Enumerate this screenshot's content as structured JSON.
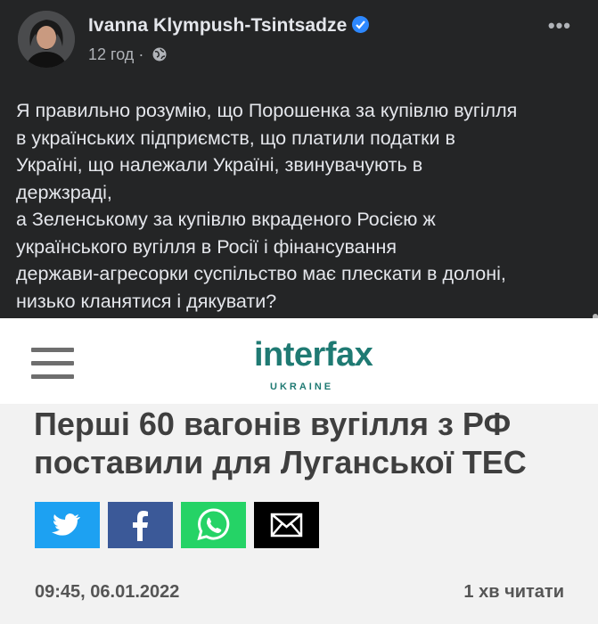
{
  "post": {
    "author": "Ivanna Klympush-Tsintsadze",
    "time": "12 год",
    "separator": "·",
    "text": "Я правильно розумію, що Порошенка за купівлю вугілля\nв українських підприємств, що платили податки в\nУкраїні, що належали Україні, звинувачують в\nдержзраді,\nа Зеленському за купівлю вкраденого Росією ж\nукраїнського вугілля в Росії і фінансування\nдержави-агресорки суспільство має плескати в долоні,\nнизько кланятися і дякувати?"
  },
  "article": {
    "logo_main": "interfax",
    "logo_sub": "UKRAINE",
    "title": "Перші 60 вагонів вугілля з РФ поставили для Луганської ТЕС",
    "date": "09:45, 06.01.2022",
    "read_time": "1 хв читати",
    "share_colors": {
      "twitter": "#1da1f2",
      "facebook": "#3b5998",
      "whatsapp": "#25d366",
      "email": "#000000"
    }
  }
}
